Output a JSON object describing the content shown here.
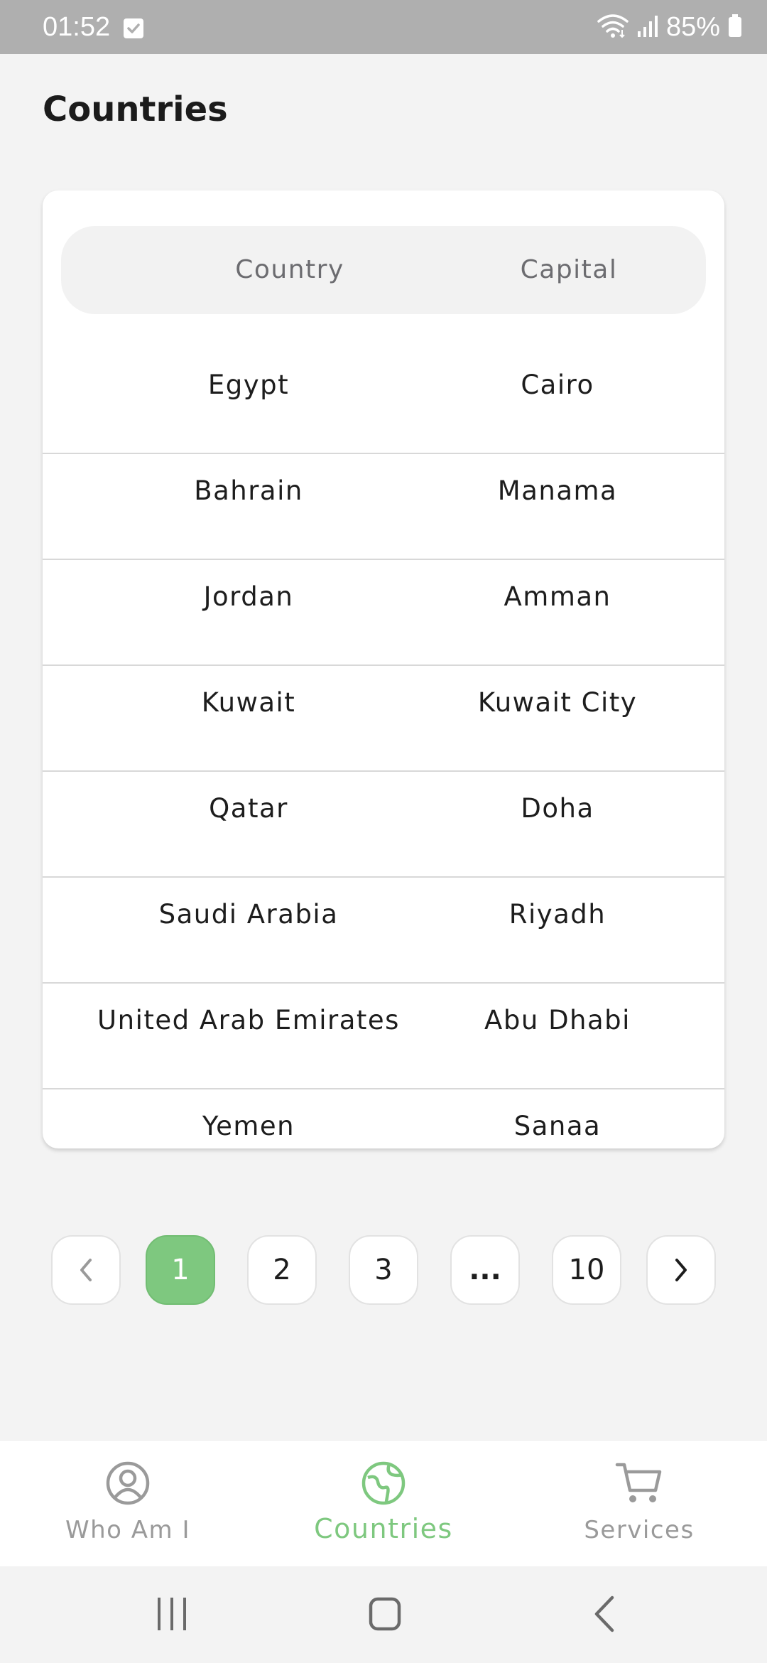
{
  "status_bar": {
    "time": "01:52",
    "battery": "85%",
    "icons": [
      "checkbox-icon",
      "wifi-icon",
      "signal-icon",
      "battery-icon"
    ]
  },
  "page": {
    "title": "Countries"
  },
  "table": {
    "headers": {
      "country": "Country",
      "capital": "Capital"
    },
    "rows": [
      {
        "country": "Egypt",
        "capital": "Cairo"
      },
      {
        "country": "Bahrain",
        "capital": "Manama"
      },
      {
        "country": "Jordan",
        "capital": "Amman"
      },
      {
        "country": "Kuwait",
        "capital": "Kuwait City"
      },
      {
        "country": "Qatar",
        "capital": "Doha"
      },
      {
        "country": "Saudi Arabia",
        "capital": "Riyadh"
      },
      {
        "country": "United Arab Emirates",
        "capital": "Abu Dhabi"
      },
      {
        "country": "Yemen",
        "capital": "Sanaa"
      }
    ]
  },
  "pagination": {
    "pages": [
      "1",
      "2",
      "3",
      "...",
      "10"
    ],
    "current": "1",
    "prev_icon": "chevron-left-icon",
    "next_icon": "chevron-right-icon"
  },
  "bottom_nav": {
    "items": [
      {
        "label": "Who Am I",
        "icon": "user-circle-icon"
      },
      {
        "label": "Countries",
        "icon": "globe-icon"
      },
      {
        "label": "Services",
        "icon": "cart-icon"
      }
    ],
    "active": "Countries"
  },
  "colors": {
    "accent": "#7ec87f",
    "status_bar": "#afafaf",
    "background": "#f3f3f3"
  },
  "system_nav": {
    "icons": [
      "recent-apps-icon",
      "home-icon",
      "back-icon"
    ]
  }
}
